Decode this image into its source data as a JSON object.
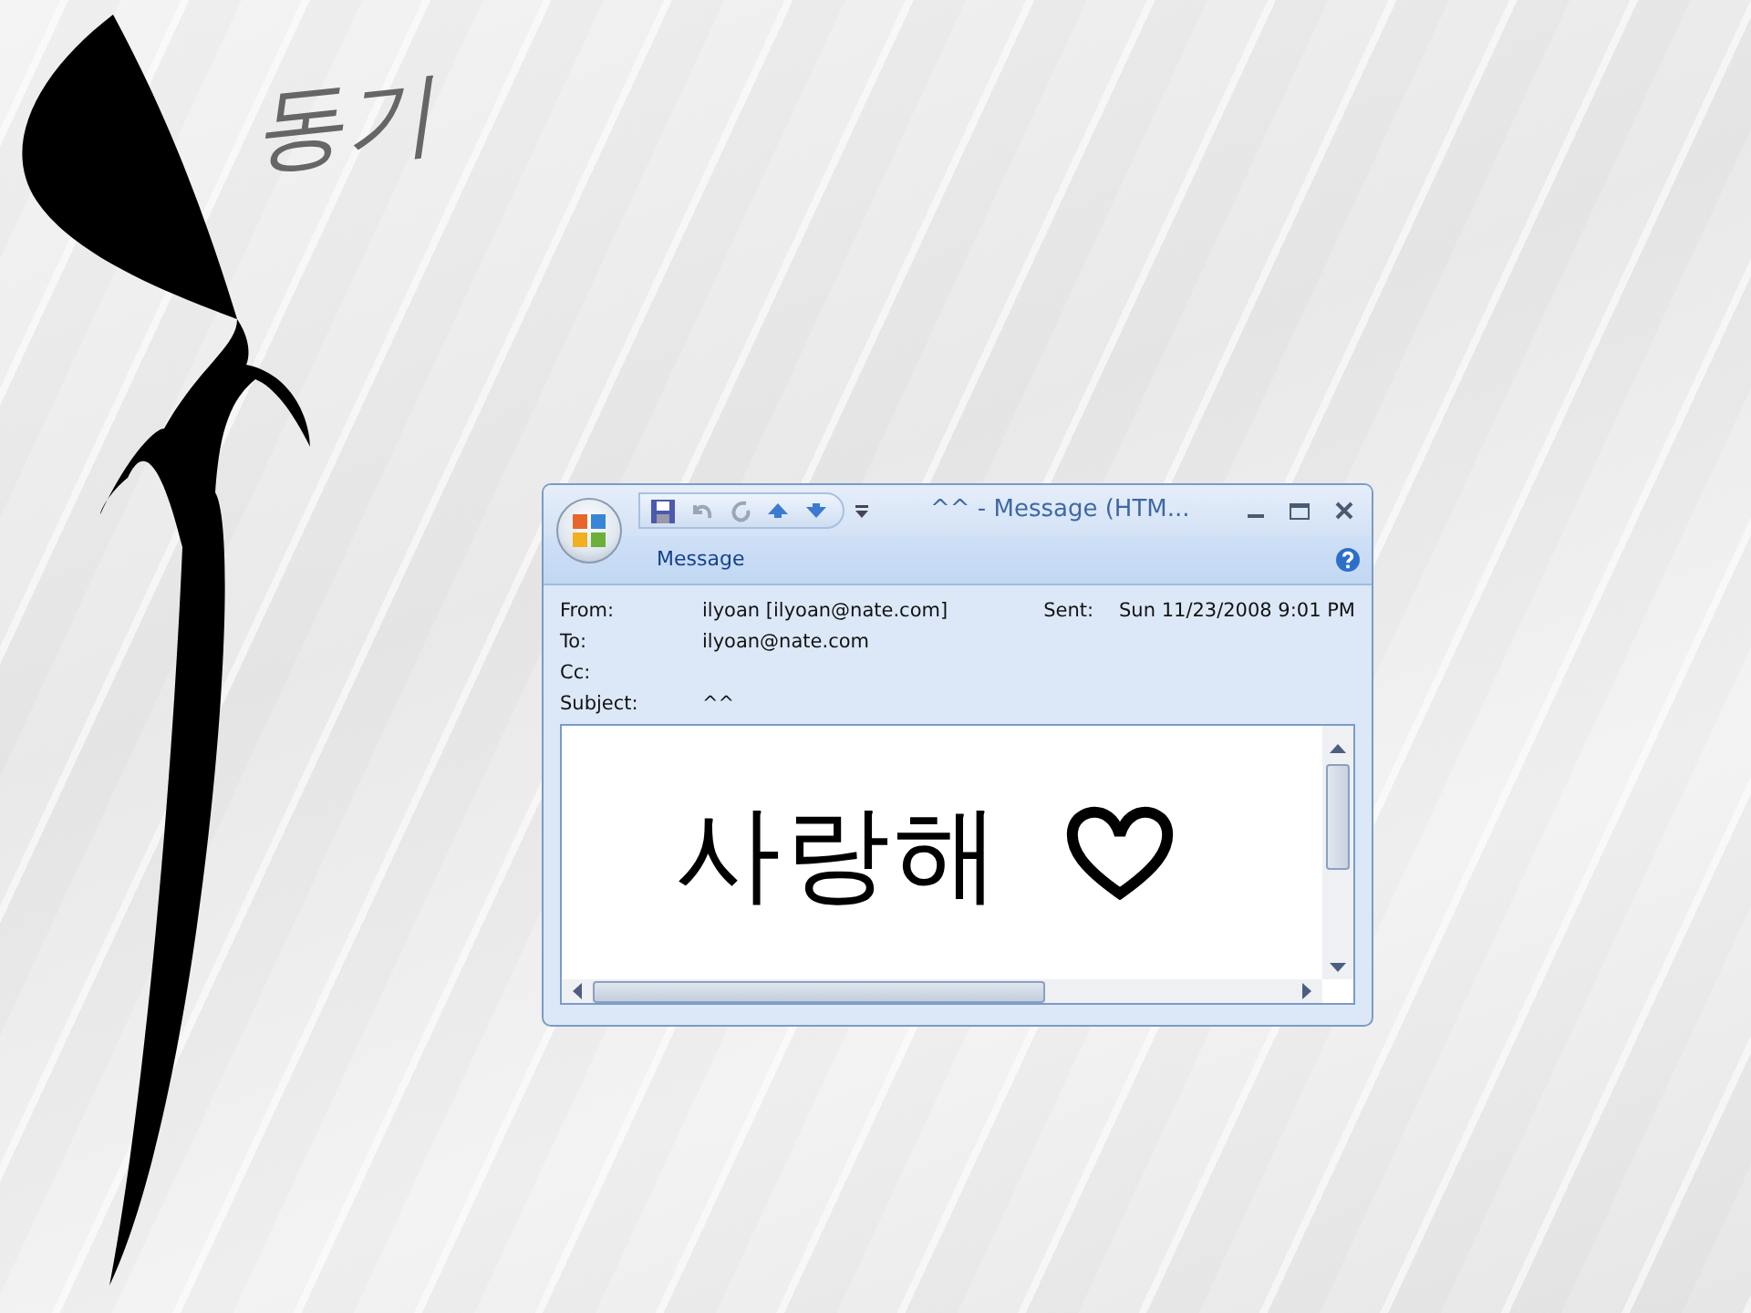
{
  "slide": {
    "title": "동기"
  },
  "window": {
    "title": "^^ - Message (HTM...",
    "ribbon_tab": "Message",
    "headers": [
      {
        "label": "From:",
        "value": "ilyoan [ilyoan@nate.com]"
      },
      {
        "label": "To:",
        "value": "ilyoan@nate.com"
      },
      {
        "label": "Cc:"
      },
      {
        "label": "Subject:",
        "value": "^^"
      }
    ],
    "sent": {
      "label": "Sent:",
      "value": "Sun 11/23/2008 9:01 PM"
    },
    "body": {
      "text": "사랑해"
    }
  }
}
